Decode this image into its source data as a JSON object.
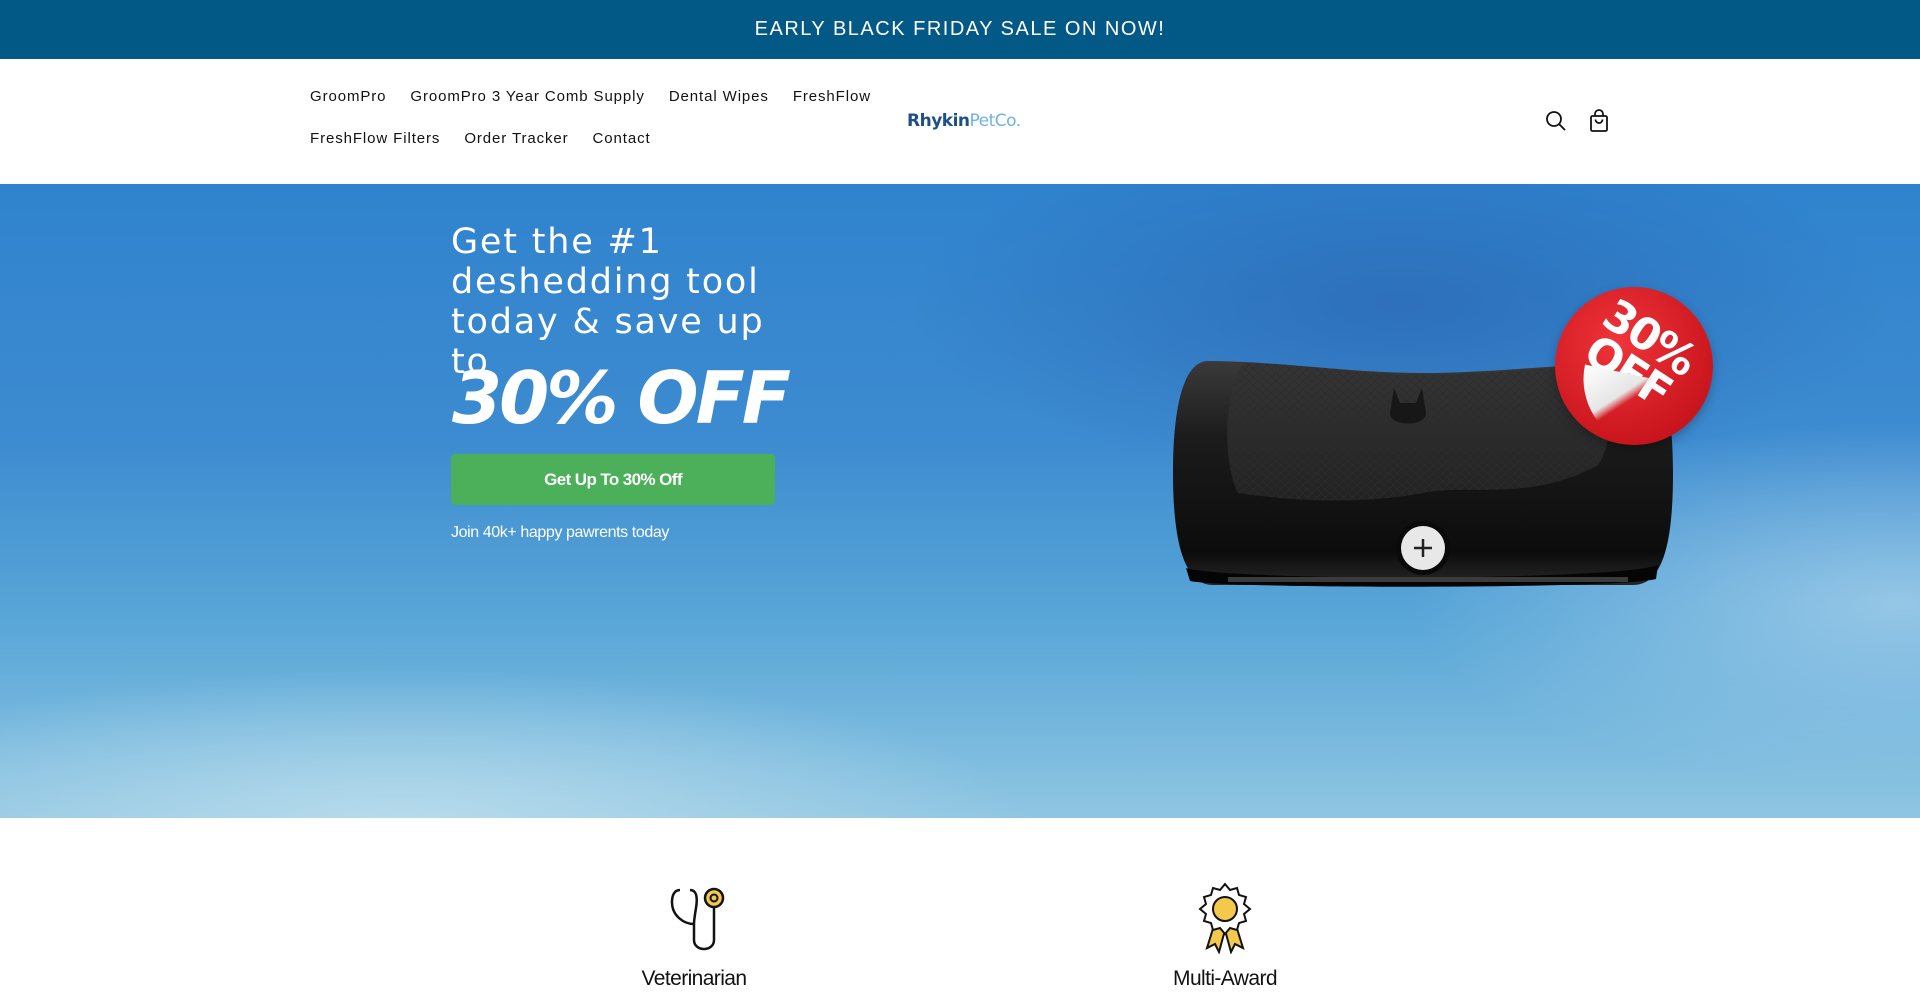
{
  "announcement": {
    "text": "EARLY BLACK FRIDAY SALE ON NOW!"
  },
  "header": {
    "nav": [
      {
        "label": "GroomPro"
      },
      {
        "label": "GroomPro 3 Year Comb Supply"
      },
      {
        "label": "Dental Wipes"
      },
      {
        "label": "FreshFlow"
      },
      {
        "label": "FreshFlow Filters"
      },
      {
        "label": "Order Tracker"
      },
      {
        "label": "Contact"
      }
    ],
    "logo": {
      "part1": "Rhykin",
      "part2": "PetCo."
    },
    "icons": {
      "search": "search-icon",
      "cart": "cart-icon"
    }
  },
  "hero": {
    "heading": "Get the #1 deshedding tool today & save up to",
    "offer": "30% OFF",
    "cta_label": "Get Up To 30% Off",
    "subtext": "Join 40k+ happy pawrents today",
    "badge": {
      "line1": "30%",
      "line2": "OFF"
    },
    "colors": {
      "cta": "#4caf5a",
      "announcement_bg": "#035986",
      "badge": "#d8222a"
    }
  },
  "features": [
    {
      "icon": "stethoscope-icon",
      "label": "Veterinarian"
    },
    {
      "icon": "award-ribbon-icon",
      "label": "Multi-Award"
    }
  ]
}
